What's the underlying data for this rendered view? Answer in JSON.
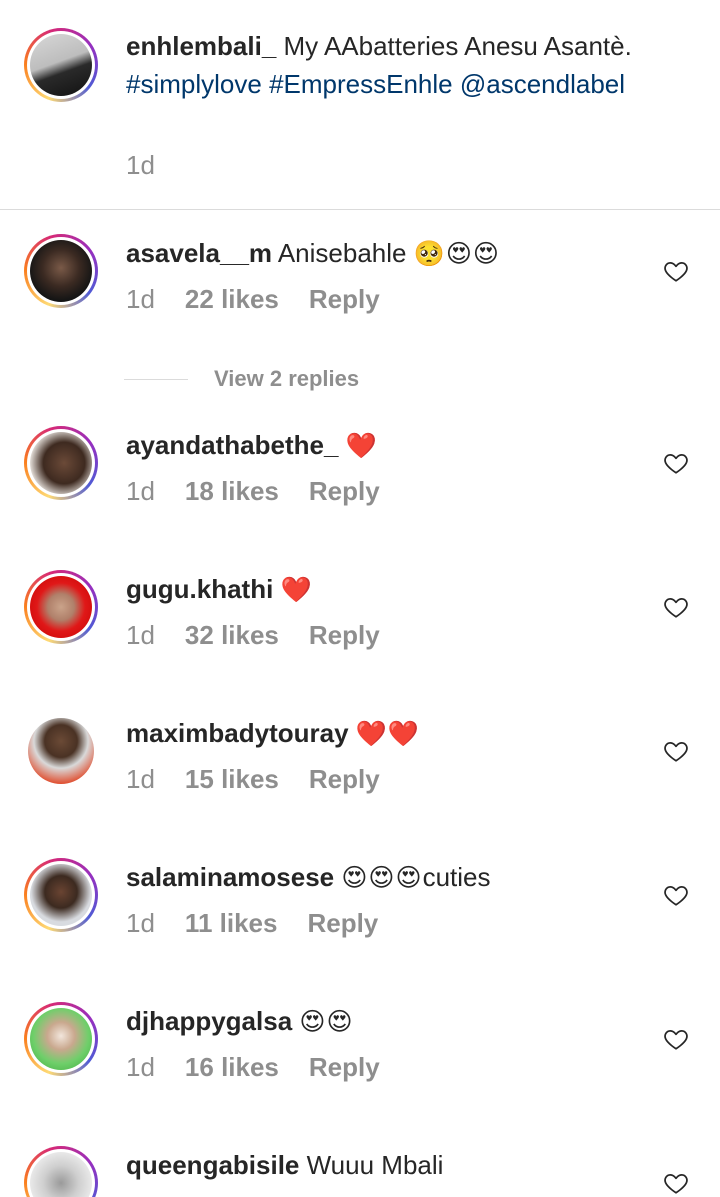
{
  "caption": {
    "username": "enhlembali_",
    "text": " My AAbatteries Anesu Asantè. ",
    "hashtag1": "#simplylove",
    "hashtag2": "#EmpressEnhle",
    "mention": "@ascendlabel",
    "time": "1d"
  },
  "comments": [
    {
      "username": "asavela__m",
      "text": " Anisebahle ",
      "emoji": "🥺😍😍",
      "time": "1d",
      "likes": "22 likes",
      "reply": "Reply"
    },
    {
      "username": "ayandathabethe_",
      "text": " ",
      "emoji": "❤️",
      "time": "1d",
      "likes": "18 likes",
      "reply": "Reply"
    },
    {
      "username": "gugu.khathi",
      "text": " ",
      "emoji": "❤️",
      "time": "1d",
      "likes": "32 likes",
      "reply": "Reply"
    },
    {
      "username": "maximbadytouray",
      "text": " ",
      "emoji": "❤️❤️",
      "time": "1d",
      "likes": "15 likes",
      "reply": "Reply"
    },
    {
      "username": "salaminamosese",
      "text": " ",
      "emoji": "😍😍😍",
      "text2": "cuties",
      "time": "1d",
      "likes": "11 likes",
      "reply": "Reply"
    },
    {
      "username": "djhappygalsa",
      "text": " ",
      "emoji": "😍😍",
      "time": "1d",
      "likes": "16 likes",
      "reply": "Reply"
    },
    {
      "username": "queengabisile",
      "text": " Wuuu Mbali"
    }
  ],
  "view_replies": "View 2 replies",
  "icons": {
    "like": "heart-outline-icon",
    "avatar_ring": "story-ring"
  },
  "colors": {
    "link": "#00376b",
    "secondary": "#8e8e8e",
    "text": "#262626",
    "divider": "#dbdbdb"
  }
}
